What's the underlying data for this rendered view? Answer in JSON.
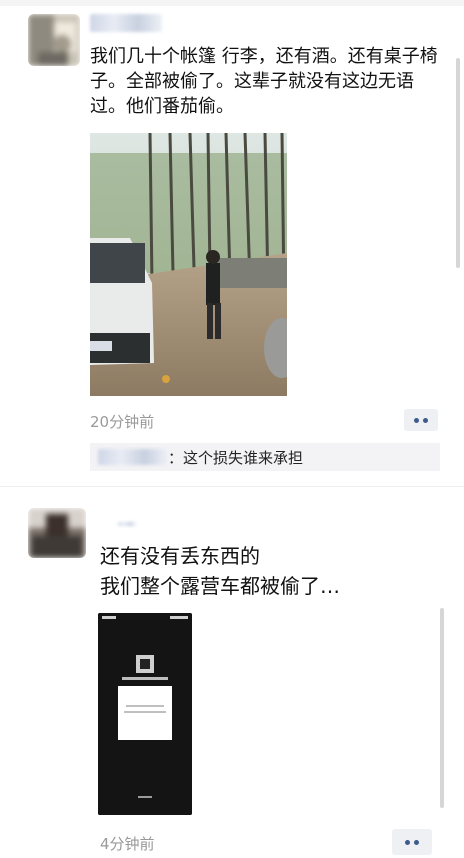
{
  "post1": {
    "text": "我们几十个帐篷 行李，还有酒。还有桌子椅子。全部被偷了。这辈子就没有这边无语过。他们番茄偷。",
    "time": "20分钟前",
    "more_icon": "more-dots-icon",
    "comment": {
      "text": "：这个损失谁来承担"
    }
  },
  "post2": {
    "text_line1": "还有没有丢东西的",
    "text_line2": "我们整个露营车都被偷了…",
    "time": "4分钟前",
    "more_icon": "more-dots-icon"
  },
  "colors": {
    "link_blue": "#3d5b8c",
    "time_gray": "#9a9a9a",
    "comment_bg": "#f3f3f5"
  }
}
